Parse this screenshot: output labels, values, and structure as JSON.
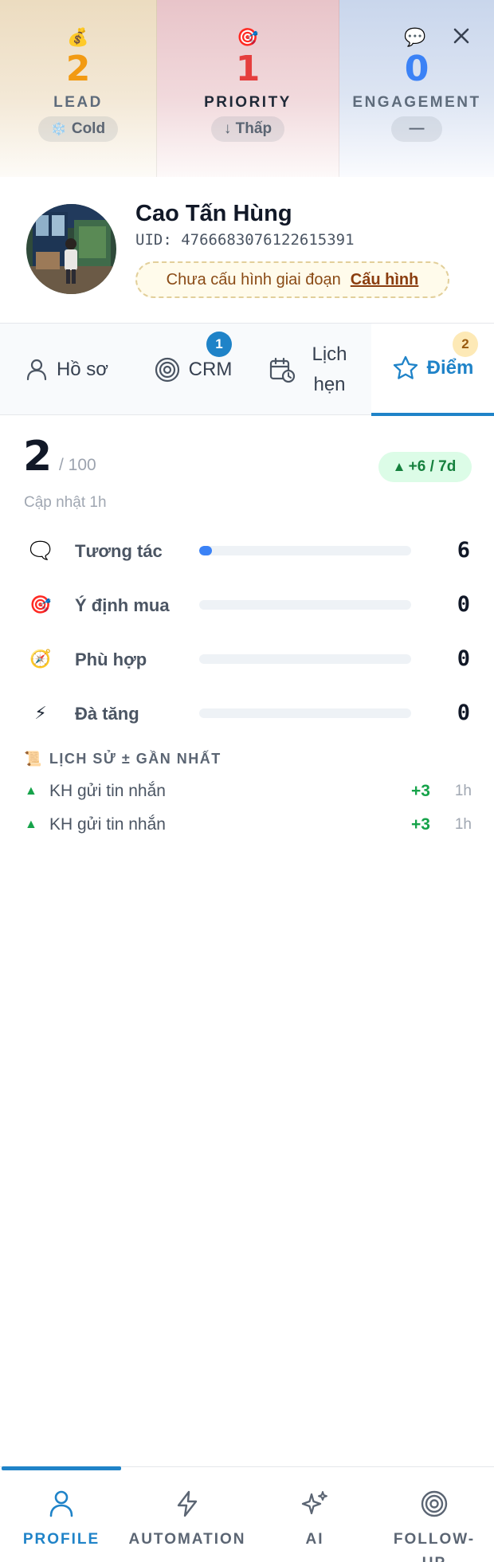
{
  "stats": {
    "lead": {
      "emoji": "💰",
      "value": "2",
      "label": "LEAD",
      "pill_icon": "❄️",
      "pill_text": "Cold"
    },
    "priority": {
      "emoji": "🎯",
      "value": "1",
      "label": "PRIORITY",
      "pill_text": "↓ Thấp"
    },
    "engagement": {
      "emoji": "💬",
      "value": "0",
      "label": "ENGAGEMENT",
      "pill_text": "—"
    }
  },
  "profile": {
    "name": "Cao Tấn Hùng",
    "uid": "UID: 4766683076122615391",
    "stage_text": "Chưa cấu hình giai đoạn",
    "stage_link": "Cấu hình"
  },
  "tabs": [
    {
      "label": "Hồ sơ",
      "icon": "user-icon",
      "active": false
    },
    {
      "label": "CRM",
      "icon": "target-icon",
      "badge": "1",
      "active": false
    },
    {
      "label": "Lịch hẹn",
      "icon": "calendar-clock-icon",
      "active": false
    },
    {
      "label": "Điểm",
      "icon": "star-icon",
      "badge": "2",
      "active": true
    }
  ],
  "score": {
    "total": "2",
    "max": "/ 100",
    "trend": "+6 / 7d",
    "updated": "Cập nhật 1h",
    "rows": [
      {
        "icon": "🗨️",
        "label": "Tương tác",
        "value": "6",
        "level": 0.06
      },
      {
        "icon": "🎯",
        "label": "Ý định mua",
        "value": "0",
        "level": 0
      },
      {
        "icon": "🧭",
        "label": "Phù hợp",
        "value": "0",
        "level": 0
      },
      {
        "icon": "⚡",
        "label": "Đà tăng",
        "value": "0",
        "level": 0
      }
    ]
  },
  "history": {
    "icon": "📜",
    "title": "LỊCH SỬ ± GẦN NHẤT",
    "items": [
      {
        "text": "KH gửi tin nhắn",
        "delta": "+3",
        "time": "1h"
      },
      {
        "text": "KH gửi tin nhắn",
        "delta": "+3",
        "time": "1h"
      }
    ]
  },
  "bottom_nav": [
    {
      "label": "PROFILE",
      "icon": "user-icon",
      "active": true
    },
    {
      "label": "AUTOMATION",
      "icon": "lightning-icon",
      "active": false
    },
    {
      "label": "AI",
      "icon": "sparkles-icon",
      "active": false
    },
    {
      "label": "FOLLOW-UP",
      "icon": "target-icon",
      "active": false
    }
  ],
  "colors": {
    "accent": "#1f83c8",
    "lead": "#f29a12",
    "priority": "#e53e3e",
    "engagement": "#3b82f6",
    "positive": "#16a34a"
  }
}
